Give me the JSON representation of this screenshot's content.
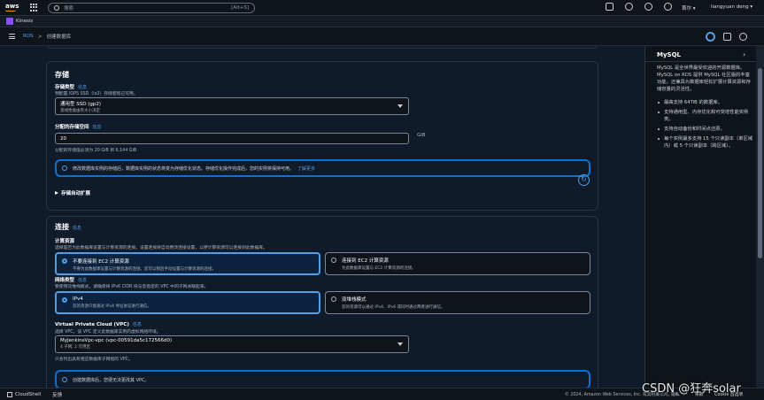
{
  "topbar": {
    "logo": "aws",
    "search_placeholder": "搜索",
    "search_shortcut": "[Alt+S]",
    "region": "首尔 ▾",
    "user": "liangyuan deng ▾"
  },
  "service": {
    "name": "Kinesis"
  },
  "breadcrumb": {
    "root": "RDS",
    "separator": ">",
    "current": "创建数据库"
  },
  "storage": {
    "title": "存储",
    "type_label": "存储类型",
    "type_info": "信息",
    "type_desc": "预配置 IOPS SSD（io2）存储卷现已可用。",
    "type_value": "通用型 SSD (gp2)",
    "type_sub": "基线性能由卷大小决定",
    "alloc_label": "分配的存储空间",
    "alloc_info": "信息",
    "alloc_value": "20",
    "alloc_unit": "GiB",
    "alloc_hint": "分配的存储值必须为 20 GiB 到 6,144 GiB",
    "alert_text": "修改数据库实例的存储后，数据库实例的状态将变为存储优化状态。存储优化操作完成后，您的实例将保持可用。",
    "alert_link": "了解更多",
    "autoscale_label": "存储自动扩展"
  },
  "connectivity": {
    "title": "连接",
    "info": "信息",
    "compute_label": "计算资源",
    "compute_desc": "选择是否为此数据库设置与计算资源的连接。设置连接将自动更改连接设置，以便计算资源可以连接到此数据库。",
    "opt1_title": "不要连接到 EC2 计算资源",
    "opt1_desc": "不要为此数据库设置与计算资源的连接。您可以稍后手动设置与计算资源的连接。",
    "opt2_title": "连接到 EC2 计算资源",
    "opt2_desc": "为此数据库设置与 EC2 计算资源的连接。",
    "net_label": "网络类型",
    "net_info": "信息",
    "net_desc": "要使用双堆栈模式，请确保将 IPv6 CIDR 块与您指定的 VPC 中的子网关联起来。",
    "ipv4_title": "IPv4",
    "ipv4_desc": "您的资源只能通过 IPv4 寻址协议进行通信。",
    "dual_title": "双堆栈模式",
    "dual_desc": "您的资源可以通过 IPv4、IPv6 或同时通过两者进行通信。",
    "vpc_label": "Virtual Private Cloud (VPC)",
    "vpc_info": "信息",
    "vpc_desc": "选择 VPC。该 VPC 定义此数据库实例的虚拟网络环境。",
    "vpc_value": "MyJenkinsVpc-vpc (vpc-00591da5c172566d0)",
    "vpc_sub": "4 子网, 2 可用区",
    "vpc_hint": "只会列出具有相应数据库子网组的 VPC。",
    "vpc_alert": "创建数据库后，您便无法更改其 VPC。"
  },
  "sidepanel": {
    "title": "MySQL",
    "intro": "MySQL 是全世界最受欢迎的开源数据库。MySQL on RDS 提供 MySQL 社区版的丰富功能，还兼具为数据库轻松扩展计算资源和存储容量的灵活性。",
    "bullets": [
      "最高支持 64TiB 的数据库。",
      "支持通用型、内存优化和可突增性能实例类。",
      "支持自动备份和时间点还原。",
      "每个实例最多支持 15 个只读副本（单区域内）或 5 个只读副本（跨区域）。"
    ]
  },
  "footer": {
    "cloudshell": "CloudShell",
    "feedback": "反馈",
    "copyright": "© 2024, Amazon Web Services, Inc. 或其附属公司。",
    "privacy": "隐私",
    "terms": "条款",
    "cookie": "Cookie 首选项"
  },
  "watermark": "CSDN @狂奔solar",
  "colors": {
    "accent": "#539fe5",
    "alert_border": "#0972d3",
    "kinesis": "#8c4fff"
  }
}
